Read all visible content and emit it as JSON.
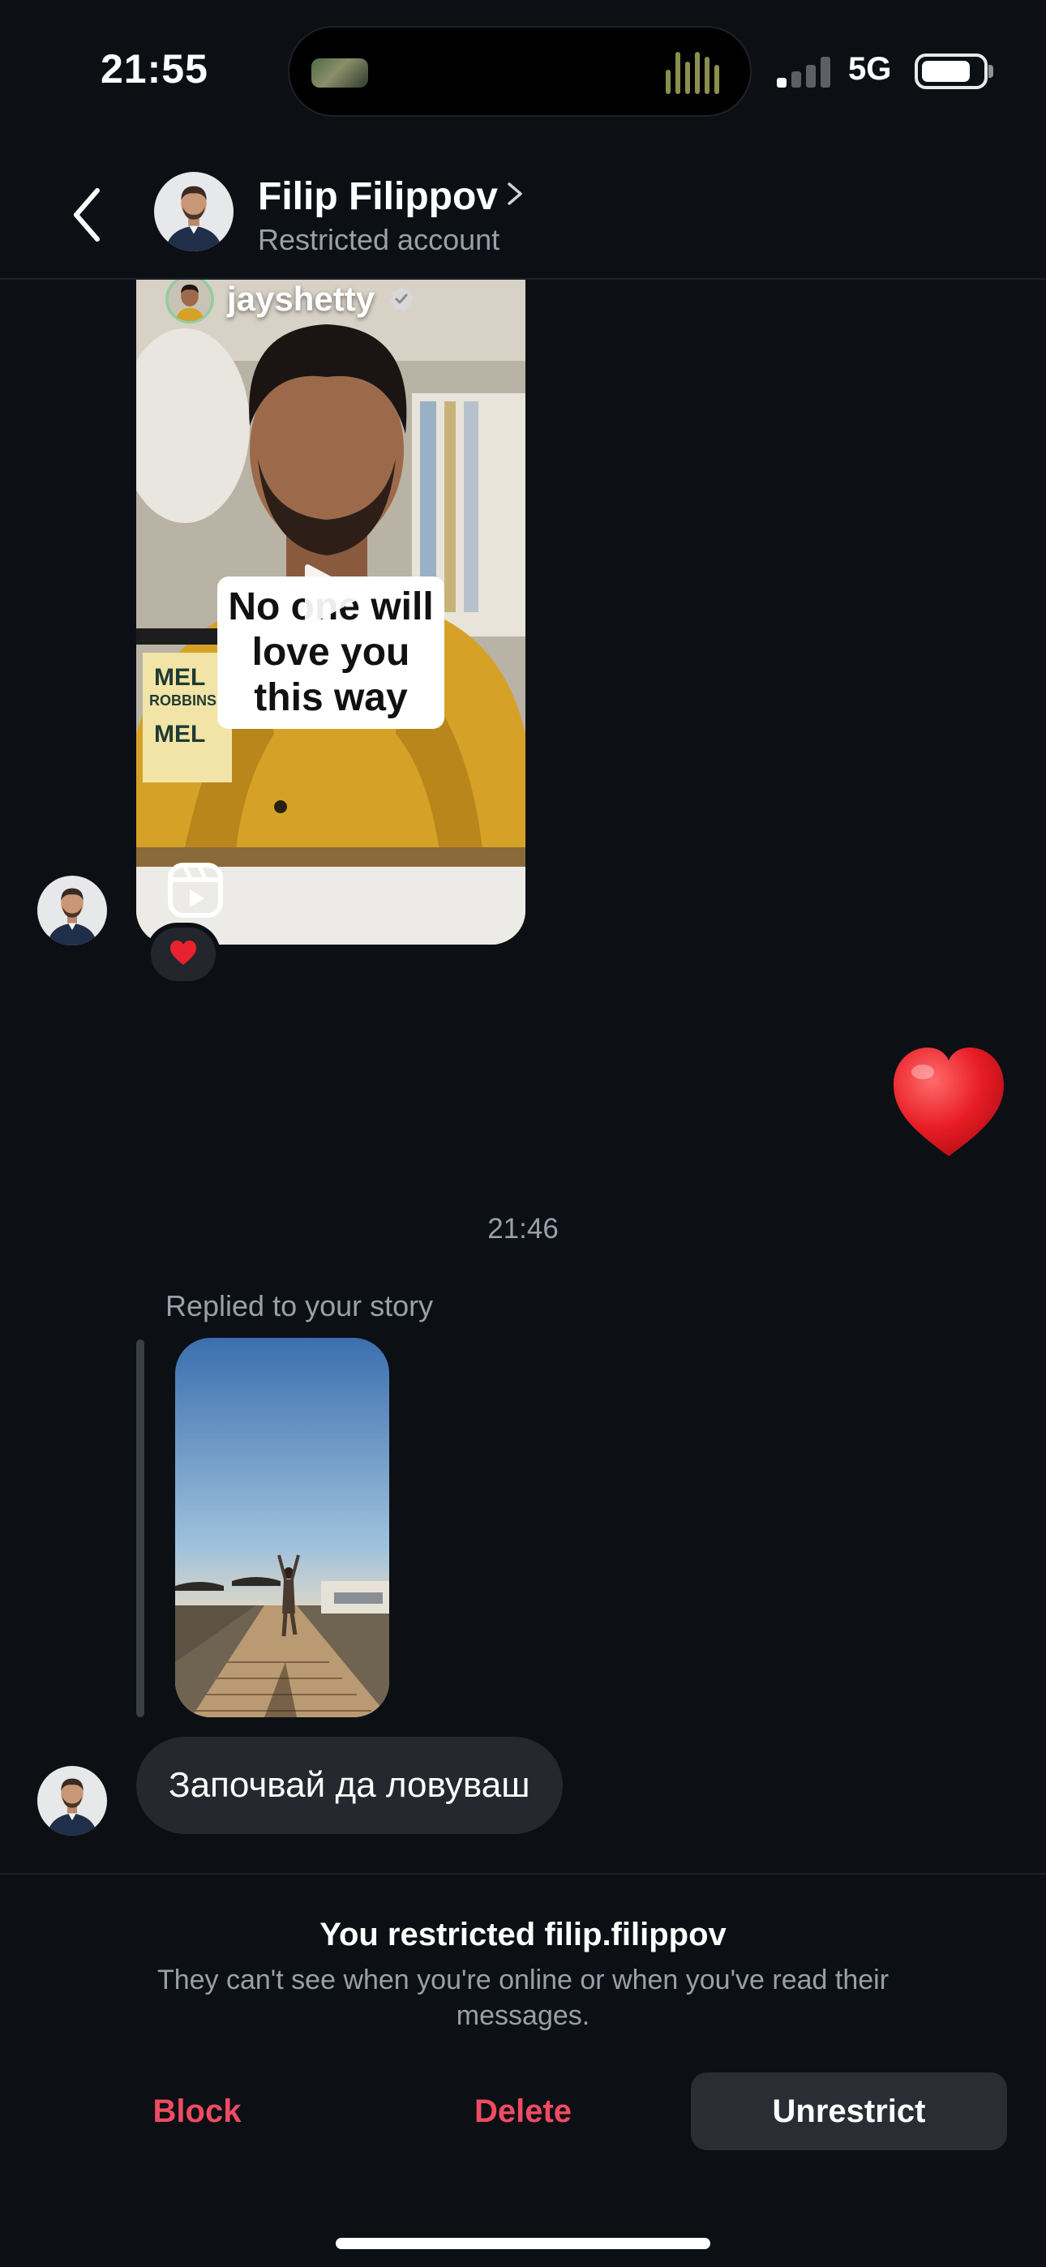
{
  "status_bar": {
    "time": "21:55",
    "network": "5G",
    "signal_bars_active": 1,
    "signal_bars_total": 4,
    "battery_level": 0.8
  },
  "header": {
    "name": "Filip Filippov",
    "subtitle": "Restricted account",
    "back_icon": "chevron-left-icon",
    "profile_chevron_icon": "chevron-right-icon"
  },
  "messages": {
    "reel": {
      "author": "jayshetty",
      "caption": "No one will love you this way",
      "reaction": "heart"
    },
    "sent_reaction": "heart",
    "timestamp": "21:46",
    "story_reply": {
      "label": "Replied to your story",
      "text": "Започвай да ловуваш"
    }
  },
  "restriction_panel": {
    "title": "You restricted filip.filippov",
    "description": "They can't see when you're online or when you've read their messages.",
    "actions": {
      "block": "Block",
      "delete": "Delete",
      "unrestrict": "Unrestrict"
    }
  },
  "colors": {
    "background": "#0c0f14",
    "danger": "#ef4b62",
    "bubble": "#25282e",
    "secondary_text": "#9aa0a8"
  }
}
